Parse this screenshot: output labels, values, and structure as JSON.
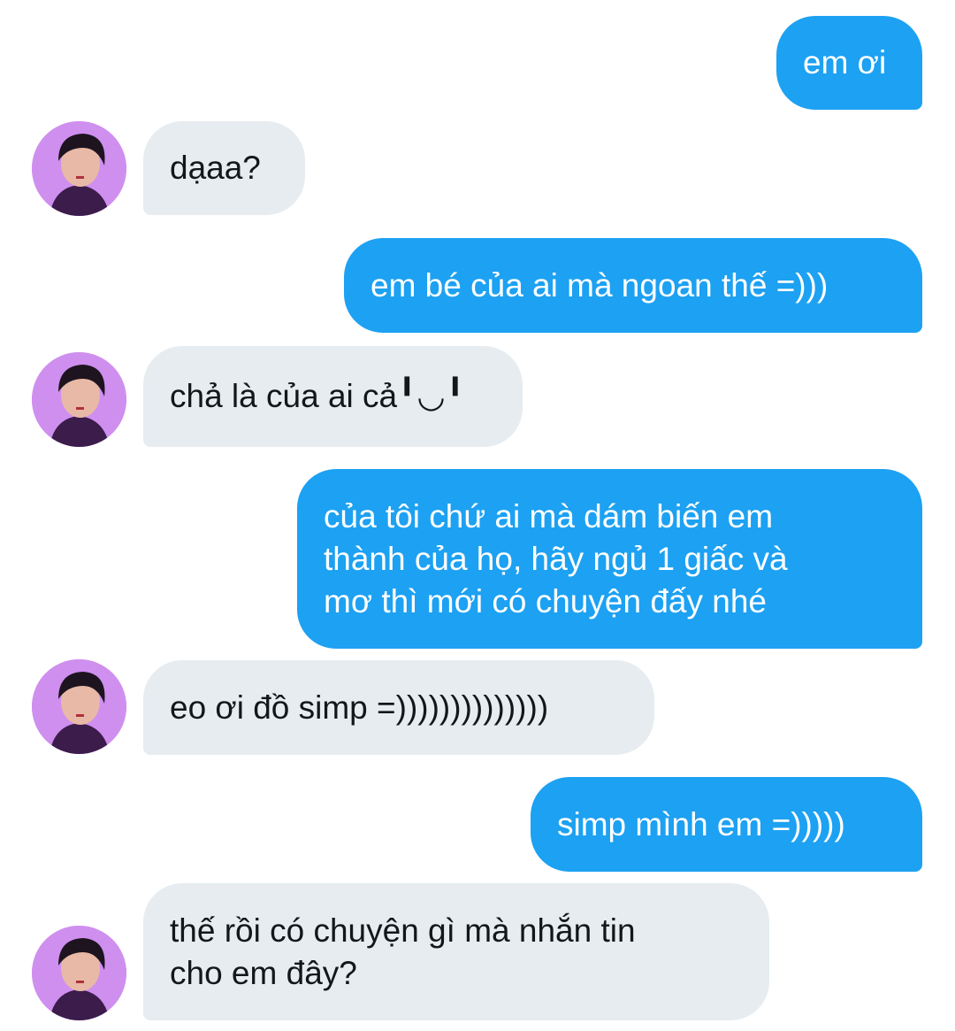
{
  "conversation": {
    "messages": [
      {
        "sender": "me",
        "text": "em ơi"
      },
      {
        "sender": "them",
        "text": "dạaa?"
      },
      {
        "sender": "me",
        "text": "em bé của ai mà ngoan thế =)))"
      },
      {
        "sender": "them",
        "text": "chả là của ai cả╹◡╹"
      },
      {
        "sender": "me",
        "text": "của tôi chứ ai mà dám biến em\nthành của họ, hãy ngủ 1 giấc và\nmơ thì mới có chuyện đấy nhé"
      },
      {
        "sender": "them",
        "text": "eo ơi đồ simp =))))))))))))))"
      },
      {
        "sender": "me",
        "text": "simp mình em =)))))"
      },
      {
        "sender": "them",
        "text": "thế rồi có chuyện gì mà nhắn tin\ncho em đây?"
      }
    ]
  },
  "colors": {
    "sent_bubble": "#1da1f2",
    "received_bubble": "#e6ecf0",
    "avatar_background": "#cf8fef"
  },
  "icons": {
    "avatar": "user-avatar-icon"
  }
}
